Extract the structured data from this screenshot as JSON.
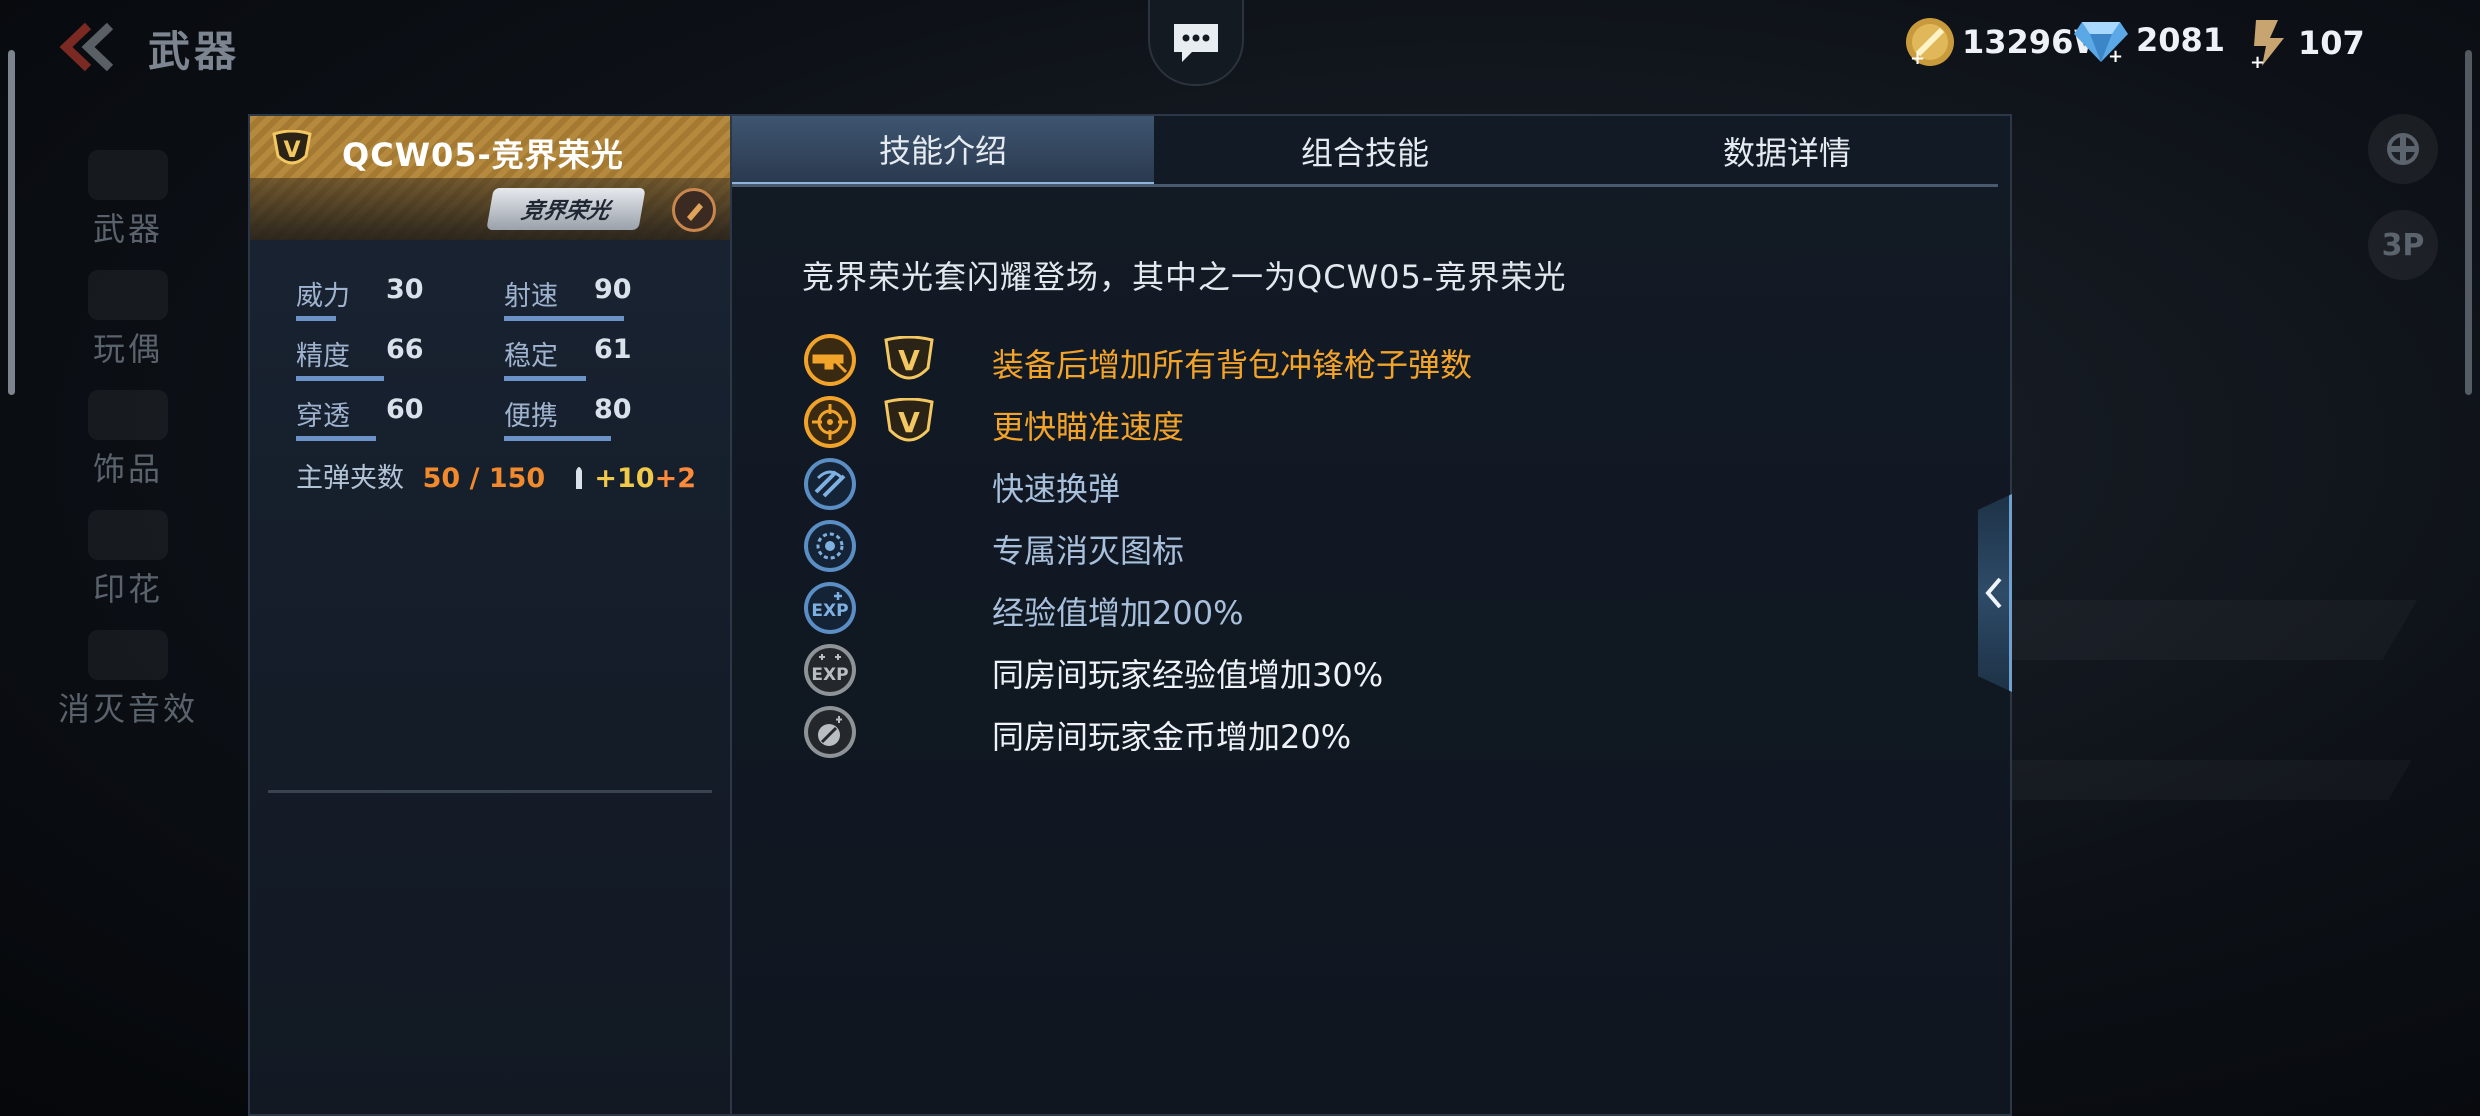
{
  "header": {
    "title": "武器",
    "currencies": [
      {
        "icon": "gold-coin-icon",
        "value": "13296W"
      },
      {
        "icon": "diamond-icon",
        "value": "2081"
      },
      {
        "icon": "key-ticket-icon",
        "value": "107"
      }
    ]
  },
  "nav": {
    "items": [
      {
        "label": "武器"
      },
      {
        "label": "玩偶"
      },
      {
        "label": "饰品"
      },
      {
        "label": "印花"
      },
      {
        "label": "消灭音效"
      }
    ]
  },
  "weapon": {
    "name": "QCW05-竞界荣光",
    "series_label": "竞界荣光",
    "stats": [
      {
        "label": "威力",
        "value": "30",
        "bar": 0.25
      },
      {
        "label": "射速",
        "value": "90",
        "bar": 0.75
      },
      {
        "label": "精度",
        "value": "66",
        "bar": 0.55
      },
      {
        "label": "稳定",
        "value": "61",
        "bar": 0.51
      },
      {
        "label": "穿透",
        "value": "60",
        "bar": 0.5
      },
      {
        "label": "便携",
        "value": "80",
        "bar": 0.67
      }
    ],
    "ammo": {
      "label": "主弹夹数",
      "value": "50 / 150",
      "bonus_a": "+10",
      "bonus_b": "+2"
    }
  },
  "tabs": [
    {
      "label": "技能介绍",
      "active": true
    },
    {
      "label": "组合技能",
      "active": false
    },
    {
      "label": "数据详情",
      "active": false
    }
  ],
  "skills": {
    "description": "竞界荣光套闪耀登场，其中之一为QCW05-竞界荣光",
    "items": [
      {
        "icon": "smg-ammo-icon",
        "text": "装备后增加所有背包冲锋枪子弹数",
        "highlight": true,
        "v_badge": true
      },
      {
        "icon": "crosshair-icon",
        "text": "更快瞄准速度",
        "highlight": true,
        "v_badge": true
      },
      {
        "icon": "reload-icon",
        "text": "快速换弹",
        "highlight": false,
        "v_badge": false
      },
      {
        "icon": "kill-mark-icon",
        "text": "专属消灭图标",
        "highlight": false,
        "v_badge": false
      },
      {
        "icon": "exp-icon",
        "text": "经验值增加200%",
        "highlight": false,
        "v_badge": false
      },
      {
        "icon": "room-exp-icon",
        "text": "同房间玩家经验值增加30%",
        "highlight": false,
        "v_badge": false
      },
      {
        "icon": "room-gold-icon",
        "text": "同房间玩家金币增加20%",
        "highlight": false,
        "v_badge": false
      }
    ]
  },
  "side_buttons": {
    "view_3p": "3P"
  },
  "colors": {
    "highlight": "#f2a32a",
    "normal_blue": "#a8c0dc",
    "normal_white": "#eef2f6",
    "gold_header": "#b58a3e"
  }
}
